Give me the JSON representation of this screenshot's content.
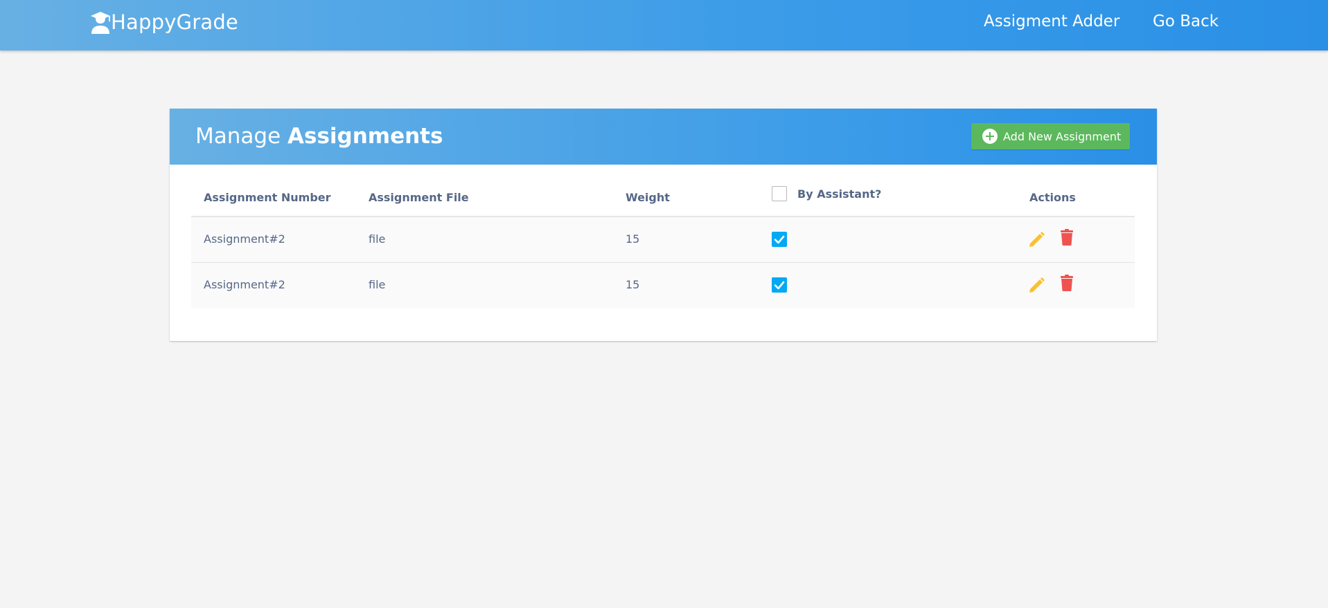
{
  "navbar": {
    "brand": "HappyGrade",
    "brand_icon": "graduate-user-icon",
    "links": [
      {
        "label": "Assigment Adder"
      },
      {
        "label": "Go Back"
      }
    ]
  },
  "manage": {
    "title_prefix": "Manage",
    "title_bold": "Assignments",
    "add_button_label": "Add New Assignment",
    "add_button_icon": "plus-circle-icon",
    "colors": {
      "header_gradient_start": "#67b0e4",
      "header_gradient_end": "#2a90e6",
      "add_button": "#5cb85c",
      "checkbox_checked": "#03a9f4",
      "edit_icon": "#fbc02d",
      "delete_icon": "#ef5350"
    }
  },
  "table": {
    "columns": [
      "Assignment Number",
      "Assignment File",
      "Weight",
      "By Assistant?",
      "Actions"
    ],
    "header_checkbox_checked": false,
    "rows": [
      {
        "number": "Assignment#2",
        "file": "file",
        "weight": "15",
        "by_assistant": true
      },
      {
        "number": "Assignment#2",
        "file": "file",
        "weight": "15",
        "by_assistant": true
      }
    ]
  }
}
